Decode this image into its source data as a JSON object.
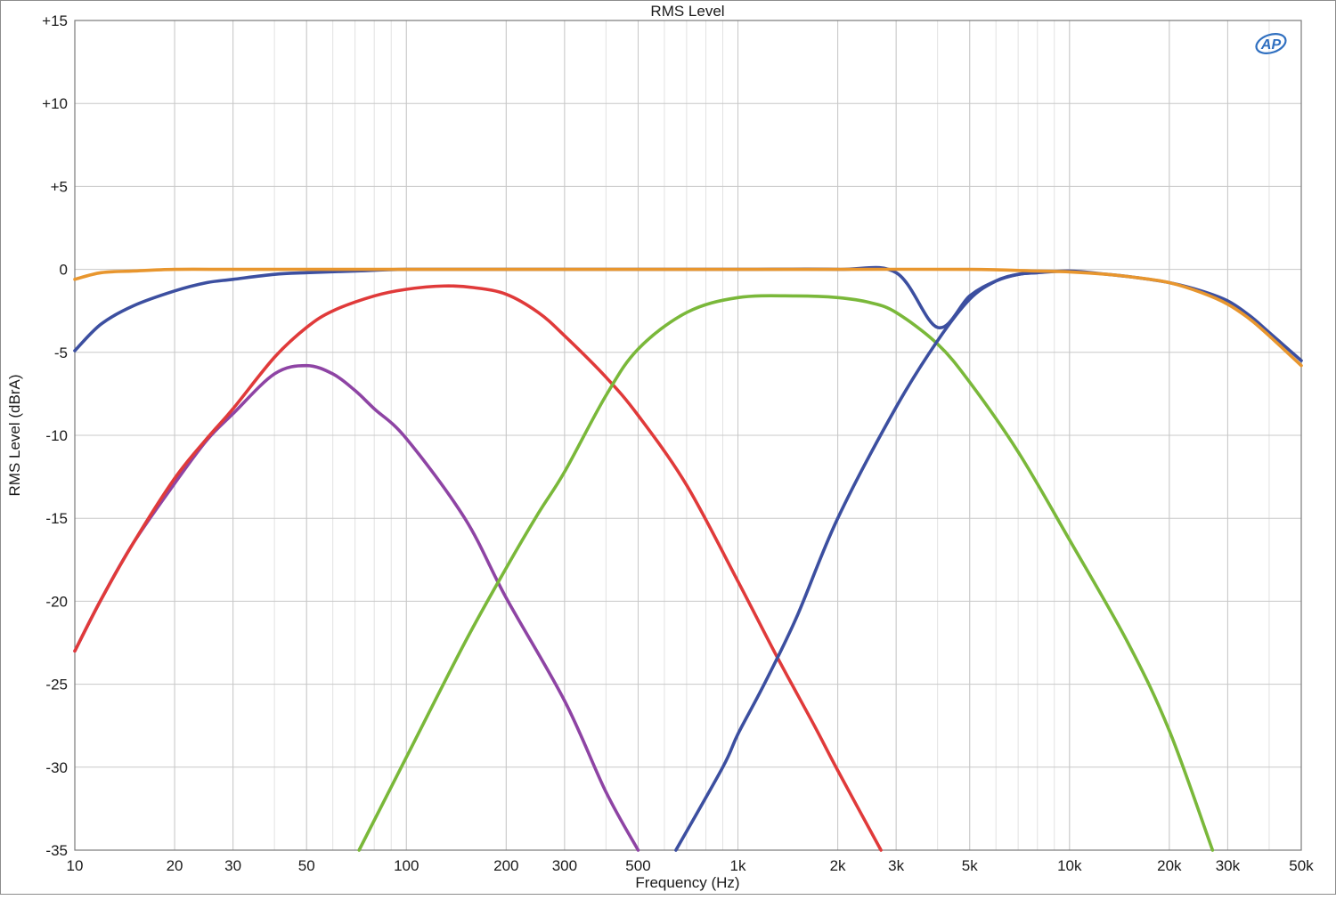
{
  "chart_data": {
    "type": "line",
    "title": "RMS Level",
    "xlabel": "Frequency (Hz)",
    "ylabel": "RMS Level (dBrA)",
    "x_scale": "log",
    "xlim": [
      10,
      50000
    ],
    "ylim": [
      -35,
      15
    ],
    "grid": true,
    "x_ticks": [
      10,
      20,
      30,
      50,
      100,
      200,
      300,
      500,
      1000,
      2000,
      3000,
      5000,
      10000,
      20000,
      30000,
      50000
    ],
    "x_tick_labels": [
      "10",
      "20",
      "30",
      "50",
      "100",
      "200",
      "300",
      "500",
      "1k",
      "2k",
      "3k",
      "5k",
      "10k",
      "20k",
      "30k",
      "50k"
    ],
    "y_ticks": [
      15,
      10,
      5,
      0,
      -5,
      -10,
      -15,
      -20,
      -25,
      -30,
      -35
    ],
    "y_tick_labels": [
      "+15",
      "+10",
      "+5",
      "0",
      "-5",
      "-10",
      "-15",
      "-20",
      "-25",
      "-30",
      "-35"
    ],
    "logo_text": "AP",
    "series": [
      {
        "color": "#e8962e",
        "points": [
          [
            10,
            -0.6
          ],
          [
            12,
            -0.2
          ],
          [
            15,
            -0.1
          ],
          [
            20,
            0.0
          ],
          [
            30,
            0.0
          ],
          [
            50,
            0.0
          ],
          [
            100,
            0.0
          ],
          [
            200,
            0.0
          ],
          [
            500,
            0.0
          ],
          [
            1000,
            0.0
          ],
          [
            2000,
            0.0
          ],
          [
            5000,
            0.0
          ],
          [
            8000,
            -0.1
          ],
          [
            10000,
            -0.15
          ],
          [
            13000,
            -0.3
          ],
          [
            16000,
            -0.5
          ],
          [
            20000,
            -0.8
          ],
          [
            25000,
            -1.4
          ],
          [
            30000,
            -2.1
          ],
          [
            35000,
            -3.0
          ],
          [
            40000,
            -4.0
          ],
          [
            50000,
            -5.8
          ]
        ]
      },
      {
        "color": "#3c4fa0",
        "points": [
          [
            10,
            -4.9
          ],
          [
            12,
            -3.3
          ],
          [
            15,
            -2.2
          ],
          [
            20,
            -1.3
          ],
          [
            25,
            -0.8
          ],
          [
            30,
            -0.6
          ],
          [
            40,
            -0.3
          ],
          [
            50,
            -0.2
          ],
          [
            70,
            -0.1
          ],
          [
            100,
            0.0
          ],
          [
            200,
            0.0
          ],
          [
            500,
            0.0
          ],
          [
            1000,
            0.0
          ],
          [
            2000,
            0.0
          ],
          [
            3000,
            -0.2
          ],
          [
            4000,
            -3.5
          ],
          [
            5000,
            -1.6
          ],
          [
            6000,
            -0.7
          ],
          [
            7000,
            -0.3
          ],
          [
            8000,
            -0.2
          ],
          [
            10000,
            -0.1
          ],
          [
            13000,
            -0.3
          ],
          [
            16000,
            -0.5
          ],
          [
            20000,
            -0.8
          ],
          [
            25000,
            -1.3
          ],
          [
            30000,
            -1.9
          ],
          [
            35000,
            -2.8
          ],
          [
            40000,
            -3.8
          ],
          [
            50000,
            -5.5
          ]
        ]
      },
      {
        "color": "#e03a3a",
        "points": [
          [
            10,
            -23.0
          ],
          [
            12,
            -19.9
          ],
          [
            15,
            -16.5
          ],
          [
            20,
            -12.6
          ],
          [
            25,
            -10.2
          ],
          [
            30,
            -8.4
          ],
          [
            40,
            -5.3
          ],
          [
            50,
            -3.5
          ],
          [
            60,
            -2.5
          ],
          [
            80,
            -1.6
          ],
          [
            100,
            -1.2
          ],
          [
            130,
            -1.0
          ],
          [
            160,
            -1.1
          ],
          [
            200,
            -1.5
          ],
          [
            250,
            -2.6
          ],
          [
            300,
            -4.0
          ],
          [
            400,
            -6.5
          ],
          [
            500,
            -8.8
          ],
          [
            700,
            -13.0
          ],
          [
            1000,
            -18.8
          ],
          [
            1300,
            -23.2
          ],
          [
            1700,
            -27.5
          ],
          [
            2000,
            -30.2
          ],
          [
            2700,
            -35.0
          ]
        ]
      },
      {
        "color": "#8e44a4",
        "points": [
          [
            10,
            -23.0
          ],
          [
            12,
            -19.9
          ],
          [
            15,
            -16.5
          ],
          [
            20,
            -12.9
          ],
          [
            25,
            -10.3
          ],
          [
            30,
            -8.7
          ],
          [
            40,
            -6.3
          ],
          [
            50,
            -5.8
          ],
          [
            60,
            -6.3
          ],
          [
            70,
            -7.3
          ],
          [
            80,
            -8.4
          ],
          [
            100,
            -10.2
          ],
          [
            150,
            -15.0
          ],
          [
            200,
            -19.8
          ],
          [
            300,
            -26.0
          ],
          [
            400,
            -31.5
          ],
          [
            500,
            -35.0
          ]
        ]
      },
      {
        "color": "#7ab83a",
        "points": [
          [
            72,
            -35.0
          ],
          [
            100,
            -29.4
          ],
          [
            150,
            -22.5
          ],
          [
            200,
            -18.0
          ],
          [
            250,
            -14.7
          ],
          [
            300,
            -12.2
          ],
          [
            400,
            -7.6
          ],
          [
            500,
            -4.8
          ],
          [
            700,
            -2.6
          ],
          [
            1000,
            -1.7
          ],
          [
            1500,
            -1.6
          ],
          [
            2000,
            -1.7
          ],
          [
            2500,
            -2.0
          ],
          [
            3000,
            -2.6
          ],
          [
            4000,
            -4.5
          ],
          [
            5000,
            -6.8
          ],
          [
            7000,
            -11.0
          ],
          [
            10000,
            -16.3
          ],
          [
            15000,
            -22.5
          ],
          [
            20000,
            -27.8
          ],
          [
            27000,
            -35.0
          ]
        ]
      },
      {
        "color": "#3c4fa0",
        "points": [
          [
            650,
            -35.0
          ],
          [
            900,
            -30.0
          ],
          [
            1000,
            -28.0
          ],
          [
            1200,
            -25.0
          ],
          [
            1500,
            -21.0
          ],
          [
            2000,
            -15.0
          ],
          [
            3000,
            -8.3
          ],
          [
            4000,
            -4.3
          ],
          [
            5000,
            -1.8
          ],
          [
            6000,
            -0.7
          ],
          [
            7000,
            -0.3
          ],
          [
            8000,
            -0.2
          ]
        ]
      }
    ]
  }
}
